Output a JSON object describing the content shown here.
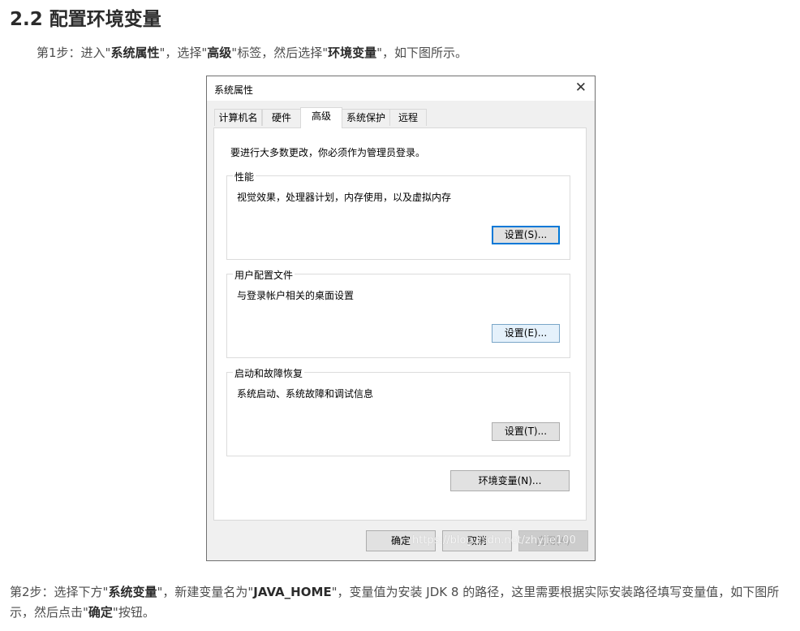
{
  "heading": "2.2 配置环境变量",
  "step1": {
    "prefix": "第1步：进入\"",
    "b1": "系统属性",
    "t1": "\"，选择\"",
    "b2": "高级",
    "t2": "\"标签，然后选择\"",
    "b3": "环境变量",
    "t3": "\"，如下图所示。"
  },
  "dialog": {
    "title": "系统属性",
    "close_glyph": "✕",
    "tabs": [
      "计算机名",
      "硬件",
      "高级",
      "系统保护",
      "远程"
    ],
    "active_tab": "高级",
    "admin_note": "要进行大多数更改，你必须作为管理员登录。",
    "performance": {
      "legend": "性能",
      "desc": "视觉效果，处理器计划，内存使用，以及虚拟内存",
      "button": "设置(S)..."
    },
    "profile": {
      "legend": "用户配置文件",
      "desc": "与登录帐户相关的桌面设置",
      "button": "设置(E)..."
    },
    "startup": {
      "legend": "启动和故障恢复",
      "desc": "系统启动、系统故障和调试信息",
      "button": "设置(T)..."
    },
    "env_button": "环境变量(N)...",
    "ok": "确定",
    "cancel": "取消",
    "apply": "应用(A)"
  },
  "watermark": "https://blog.csdn.net/zhyjie100",
  "step2": {
    "prefix": "第2步：选择下方\"",
    "b1": "系统变量",
    "t1": "\"，新建变量名为\"",
    "b2": "JAVA_HOME",
    "t2": "\"，变量值为安装 JDK 8 的路径，这里需要根据实际安装路径填写变量值，如下图所示，然后点击\"",
    "b3": "确定",
    "t3": "\"按钮。"
  },
  "colors": {
    "focus_border": "#0078d7",
    "dialog_bg": "#f0f0f0"
  }
}
